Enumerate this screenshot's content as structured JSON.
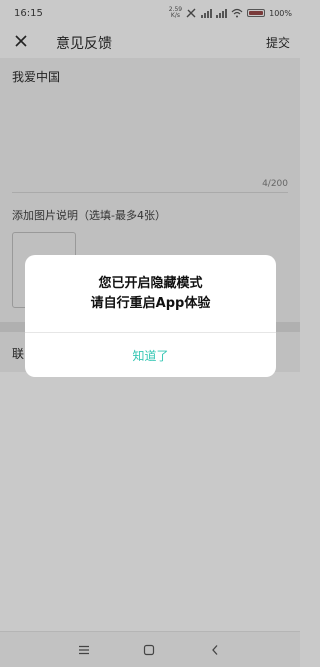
{
  "status_bar": {
    "time": "16:15",
    "net_speed_top": "2.59",
    "net_speed_bottom": "K/s",
    "battery_label": "100%",
    "icons": [
      "nfc-icon",
      "signal-icon",
      "signal-icon",
      "wifi-icon",
      "battery-icon"
    ]
  },
  "header": {
    "close_icon": "close-icon",
    "title": "意见反馈",
    "submit_label": "提交"
  },
  "feedback": {
    "text": "我爱中国",
    "char_count": "4/200"
  },
  "images": {
    "hint": "添加图片说明（选填-最多4张）"
  },
  "contact": {
    "label": "联"
  },
  "dialog": {
    "line1": "您已开启隐藏模式",
    "line2": "请自行重启App体验",
    "ok_label": "知道了",
    "accent_color": "#36c7b4"
  },
  "nav": {
    "icons": [
      "menu-icon",
      "home-icon",
      "back-icon"
    ]
  }
}
